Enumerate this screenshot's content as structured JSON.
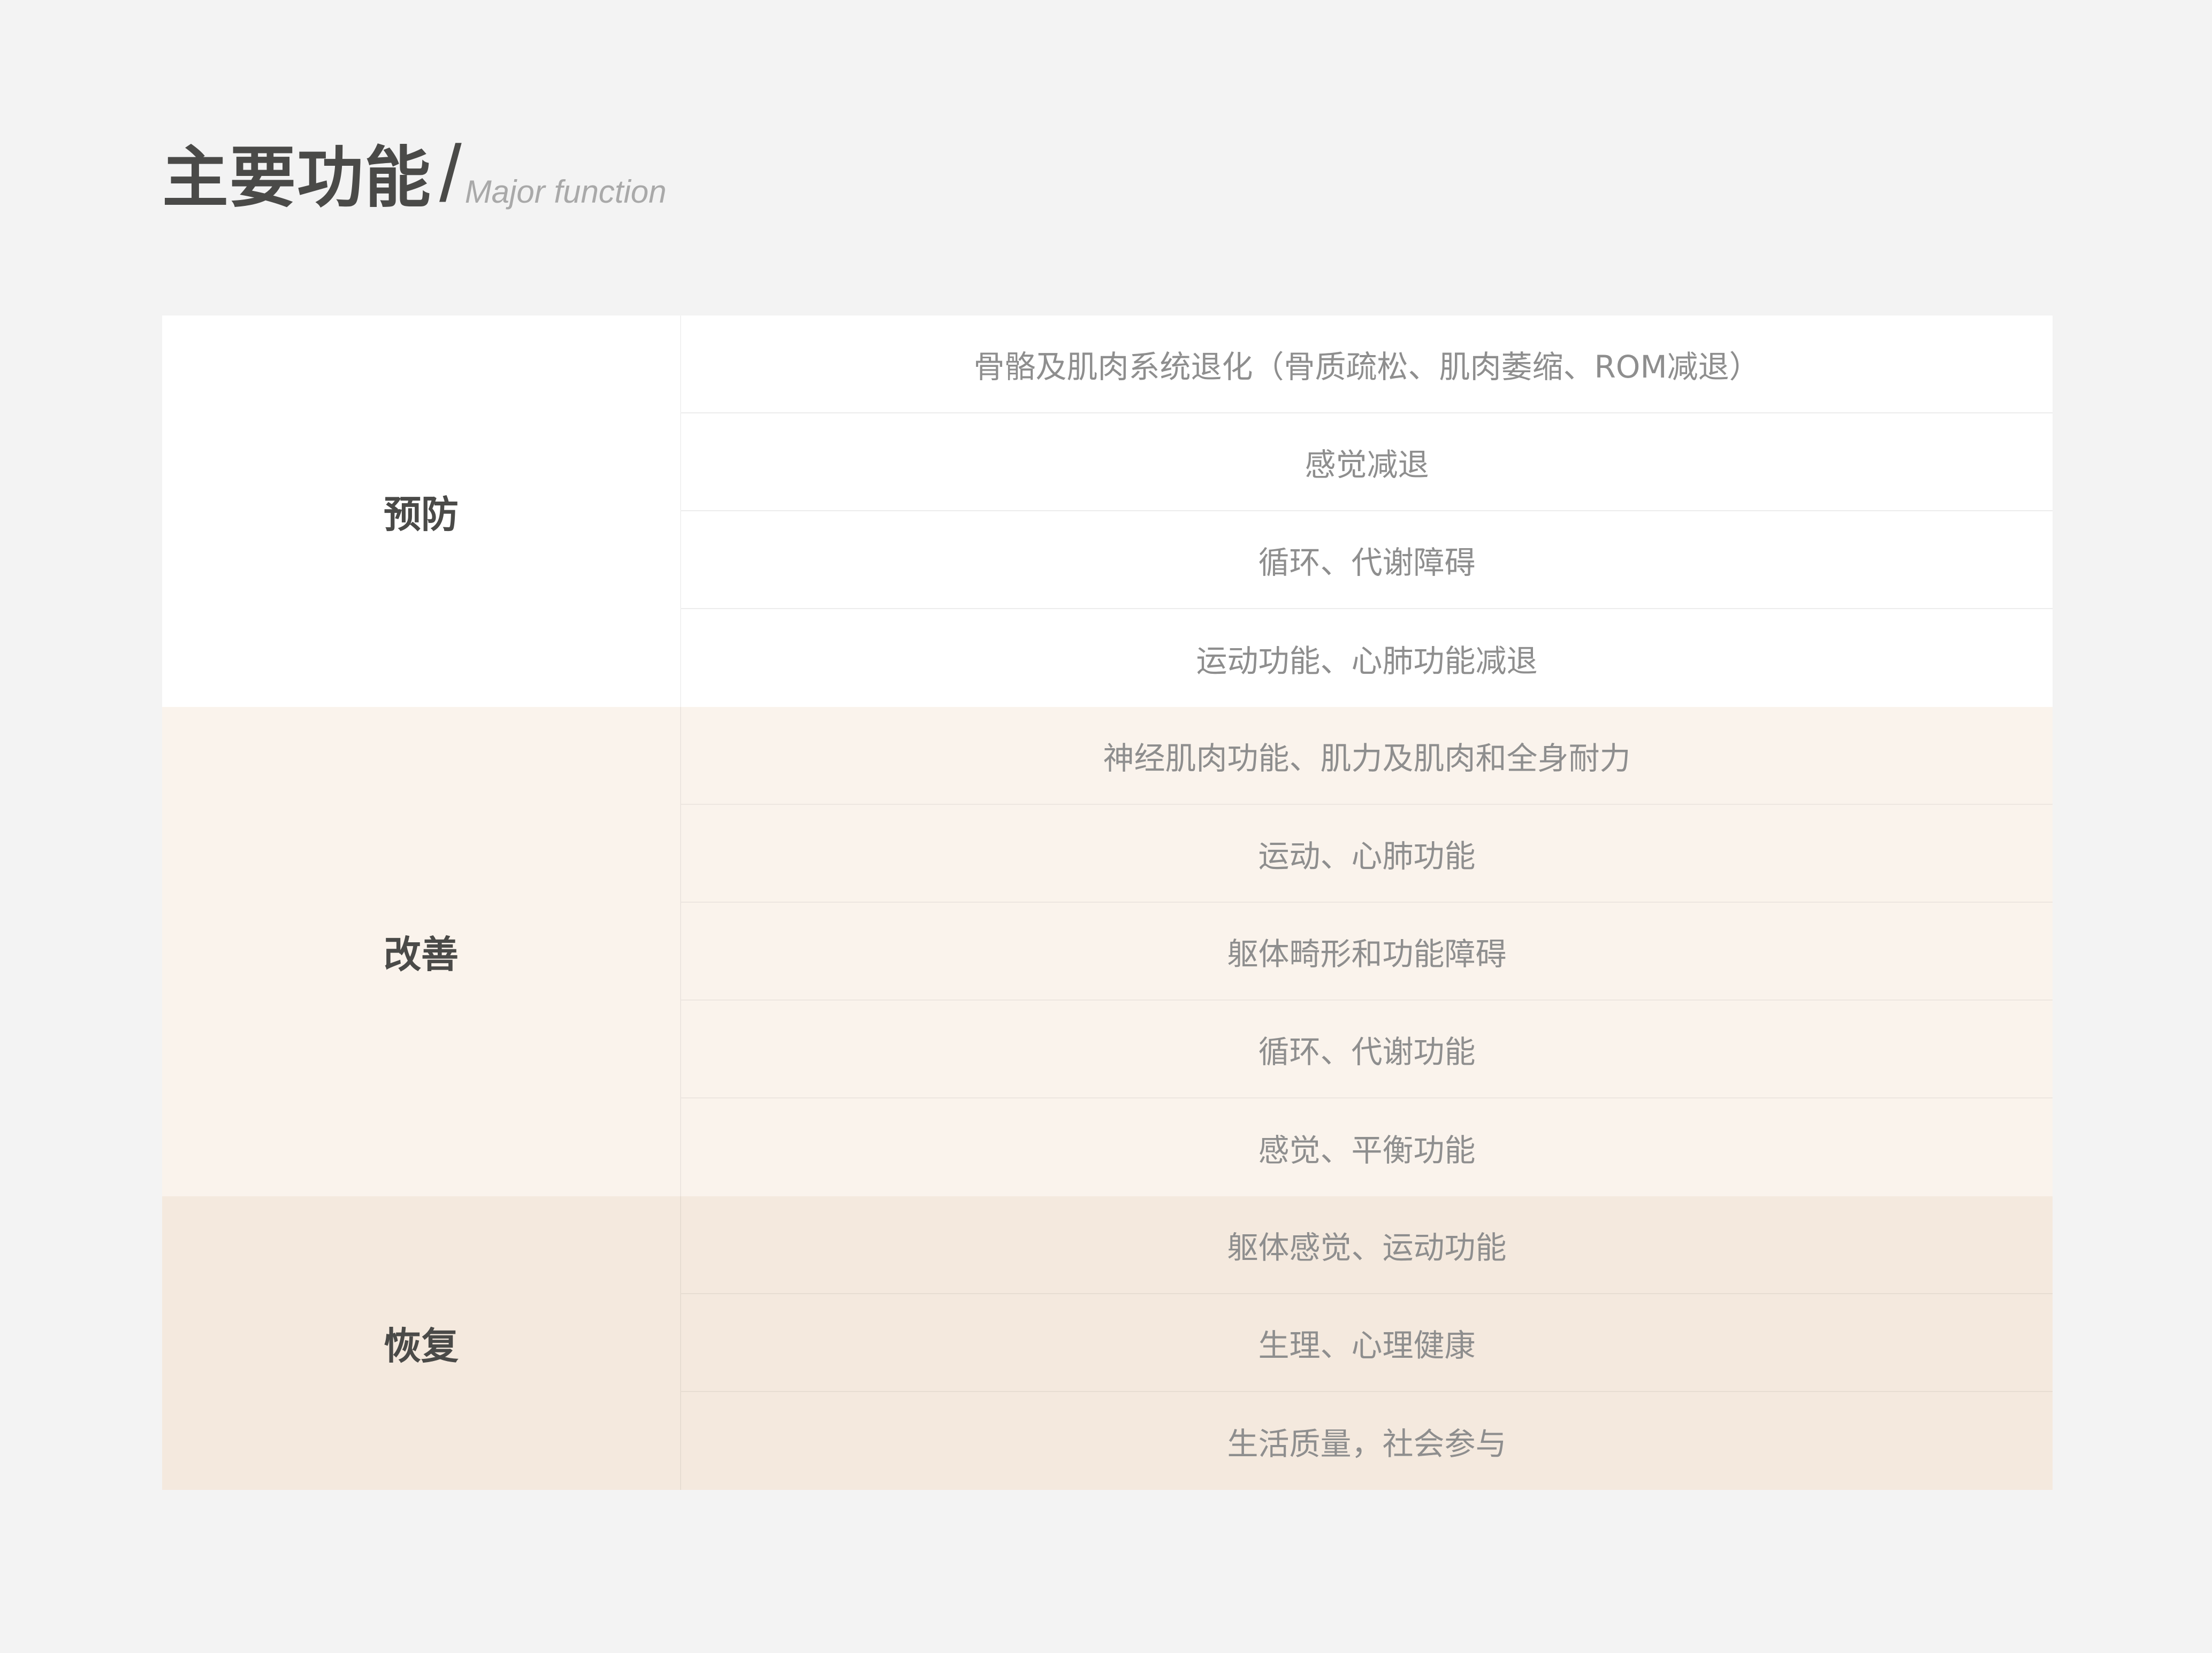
{
  "header": {
    "title": "主要功能",
    "slash": "/",
    "subtitle": "Major function"
  },
  "groups": [
    {
      "category": "预防",
      "items": [
        "骨骼及肌肉系统退化（骨质疏松、肌肉萎缩、ROM减退）",
        "感觉减退",
        "循环、代谢障碍",
        "运动功能、心肺功能减退"
      ]
    },
    {
      "category": "改善",
      "items": [
        "神经肌肉功能、肌力及肌肉和全身耐力",
        "运动、心肺功能",
        "躯体畸形和功能障碍",
        "循环、代谢功能",
        "感觉、平衡功能"
      ]
    },
    {
      "category": "恢复",
      "items": [
        "躯体感觉、运动功能",
        "生理、心理健康",
        "生活质量，社会参与"
      ]
    }
  ]
}
